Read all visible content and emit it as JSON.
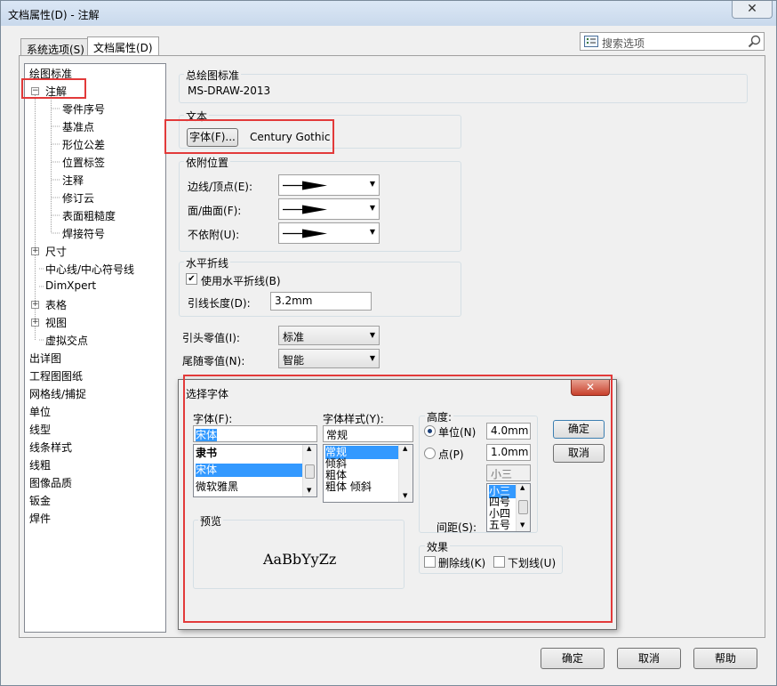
{
  "window": {
    "title": "文档属性(D) - 注解",
    "close_glyph": "✕",
    "tabs": [
      {
        "label": "系统选项(S)"
      },
      {
        "label": "文档属性(D)"
      }
    ],
    "search_placeholder": "搜索选项"
  },
  "tree": {
    "items": [
      {
        "label": "绘图标准"
      },
      {
        "label": "注解"
      },
      {
        "label": "零件序号"
      },
      {
        "label": "基准点"
      },
      {
        "label": "形位公差"
      },
      {
        "label": "位置标签"
      },
      {
        "label": "注释"
      },
      {
        "label": "修订云"
      },
      {
        "label": "表面粗糙度"
      },
      {
        "label": "焊接符号"
      },
      {
        "label": "尺寸"
      },
      {
        "label": "中心线/中心符号线"
      },
      {
        "label": "DimXpert"
      },
      {
        "label": "表格"
      },
      {
        "label": "视图"
      },
      {
        "label": "虚拟交点"
      },
      {
        "label": "出详图"
      },
      {
        "label": "工程图图纸"
      },
      {
        "label": "网格线/捕捉"
      },
      {
        "label": "单位"
      },
      {
        "label": "线型"
      },
      {
        "label": "线条样式"
      },
      {
        "label": "线粗"
      },
      {
        "label": "图像品质"
      },
      {
        "label": "钣金"
      },
      {
        "label": "焊件"
      }
    ]
  },
  "settings": {
    "overall_standard_label": "总绘图标准",
    "overall_standard_value": "MS-DRAW-2013",
    "text_label": "文本",
    "font_button": "字体(F)...",
    "font_value": "Century Gothic",
    "attachment_label": "依附位置",
    "edge_vertex": "边线/顶点(E):",
    "face_surface": "面/曲面(F):",
    "unattached": "不依附(U):",
    "bent_leader_label": "水平折线",
    "use_bent_leader": "使用水平折线(B)",
    "leader_length_label": "引线长度(D):",
    "leader_length_value": "3.2mm",
    "leading_zeros_label": "引头零值(I):",
    "leading_zeros_value": "标准",
    "trailing_zeros_label": "尾随零值(N):",
    "trailing_zeros_value": "智能"
  },
  "font_dialog": {
    "title": "选择字体",
    "font_label": "字体(F):",
    "font_value": "宋体",
    "font_list": [
      "隶书",
      "宋体",
      "微软雅黑"
    ],
    "font_selected_index": 1,
    "style_label": "字体样式(Y):",
    "style_value": "常规",
    "style_list": [
      "常规",
      "倾斜",
      "粗体",
      "粗体 倾斜"
    ],
    "style_selected_index": 0,
    "height_label": "高度:",
    "units_label": "单位(N)",
    "units_value": "4.0mm",
    "points_label": "点(P)",
    "points_value": "1.0mm",
    "size_value": "小三",
    "size_list": [
      "小三",
      "四号",
      "小四",
      "五号"
    ],
    "size_selected_index": 0,
    "spacing_label": "间距(S):",
    "preview_label": "预览",
    "preview_text": "AaBbYyZz",
    "effects_label": "效果",
    "strikeout_label": "删除线(K)",
    "underline_label": "下划线(U)",
    "ok_button": "确定",
    "cancel_button": "取消"
  },
  "footer": {
    "ok_button": "确定",
    "cancel_button": "取消",
    "help_button": "帮助"
  }
}
